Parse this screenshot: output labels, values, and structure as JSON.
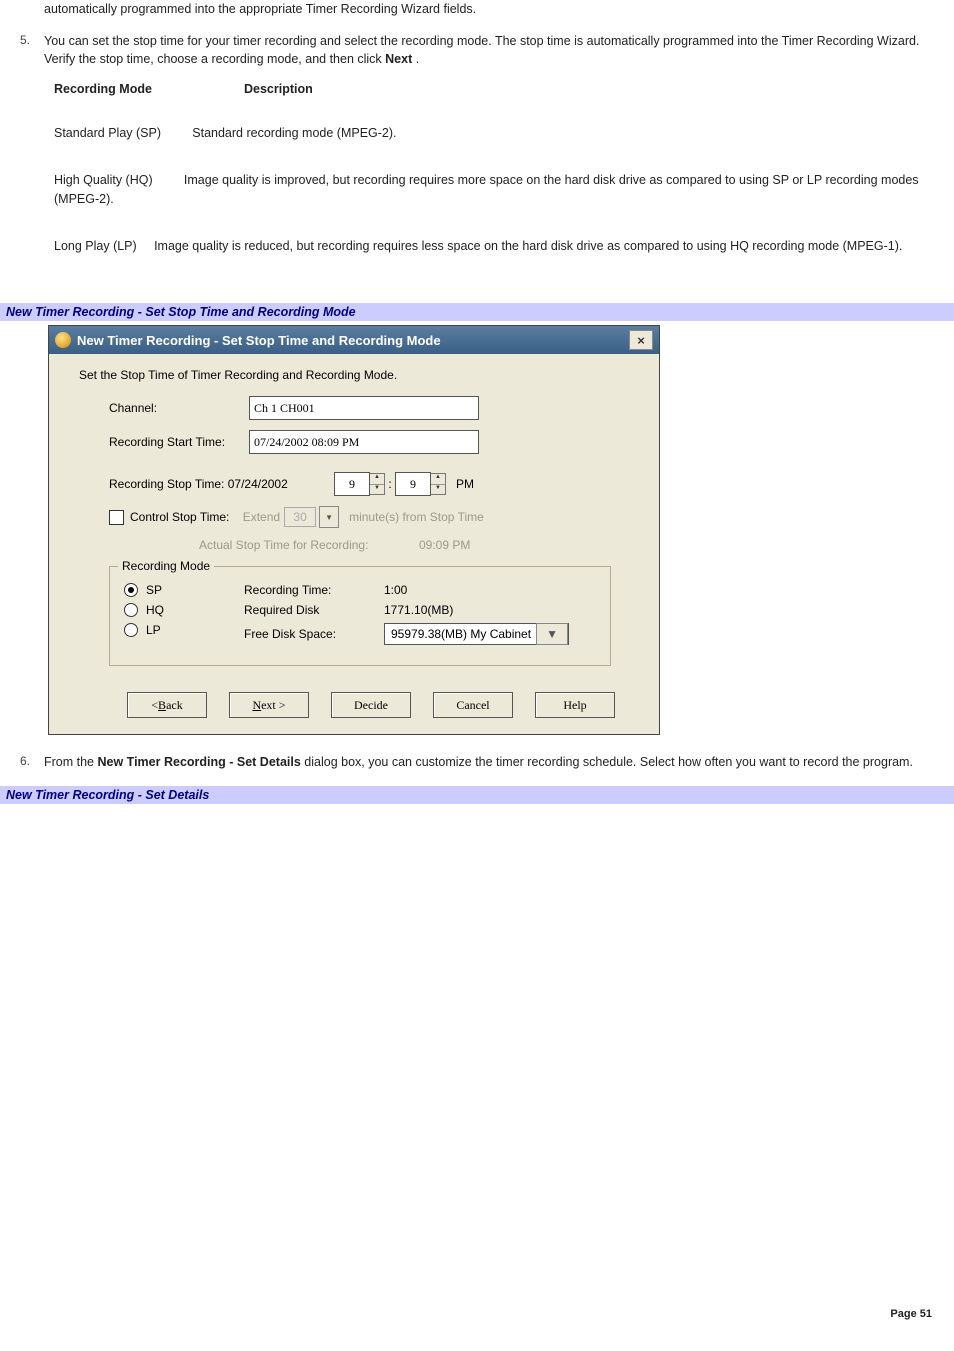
{
  "intro_frag": "automatically programmed into the appropriate Timer Recording Wizard fields.",
  "step5": {
    "num": "5.",
    "text_a": "You can set the stop time for your timer recording and select the recording mode. The stop time is automatically programmed into the Timer Recording Wizard. Verify the stop time, choose a recording mode, and then click ",
    "text_bold": "Next",
    "text_b": " ."
  },
  "modes_header": {
    "c1": "Recording Mode",
    "c2": "Description"
  },
  "modes": {
    "sp": {
      "name": "Standard Play (SP)",
      "desc": "Standard recording mode (MPEG-2)."
    },
    "hq": {
      "name": "High Quality (HQ)",
      "desc": "Image quality is improved, but recording requires more space on the hard disk drive as compared to using SP or LP recording modes (MPEG-2)."
    },
    "lp": {
      "name": "Long Play (LP)",
      "desc": "Image quality is reduced, but recording requires less space on the hard disk drive as compared to using HQ recording mode (MPEG-1)."
    }
  },
  "bar1": "New Timer Recording - Set Stop Time and Recording Mode",
  "dlg": {
    "title": "New Timer Recording - Set Stop Time and Recording Mode",
    "close": "×",
    "intro": "Set the Stop Time of Timer Recording and Recording Mode.",
    "channel_lbl": "Channel:",
    "channel_val": "Ch 1 CH001",
    "start_lbl": "Recording Start Time:",
    "start_val": "07/24/2002 08:09 PM",
    "stop_lbl": "Recording Stop Time: 07/24/2002",
    "stop_h": "9",
    "stop_m": "9",
    "ampm": "PM",
    "ctrl_lbl": "Control Stop Time:",
    "extend": "Extend",
    "extend_val": "30",
    "extend_tail": "minute(s) from Stop Time",
    "actual_lbl": "Actual Stop Time for Recording:",
    "actual_val": "09:09 PM",
    "group": "Recording Mode",
    "sp": "SP",
    "hq": "HQ",
    "lp": "LP",
    "rec_time_lbl": "Recording Time:",
    "rec_time_val": "1:00",
    "req_disk_lbl": "Required Disk",
    "req_disk_val": "1771.10(MB)",
    "free_lbl": "Free Disk Space:",
    "free_val": "95979.38(MB) My Cabinet",
    "btn_back_pre": "< ",
    "btn_back_u": "B",
    "btn_back_post": "ack",
    "btn_next_u": "N",
    "btn_next_post": "ext >",
    "btn_decide": "Decide",
    "btn_cancel": "Cancel",
    "btn_help": "Help"
  },
  "step6": {
    "num": "6.",
    "a": "From the ",
    "bold": "New Timer Recording - Set Details",
    "b": " dialog box, you can customize the timer recording schedule. Select how often you want to record the program."
  },
  "bar2": "New Timer Recording - Set Details",
  "page": "Page 51"
}
